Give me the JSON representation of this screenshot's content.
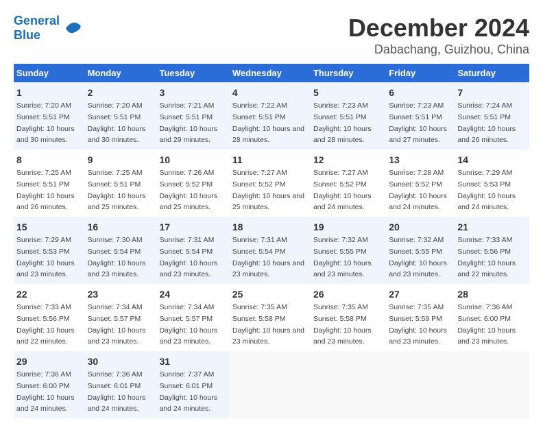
{
  "logo": {
    "text_general": "General",
    "text_blue": "Blue",
    "icon": "▶"
  },
  "title": "December 2024",
  "location": "Dabachang, Guizhou, China",
  "days_of_week": [
    "Sunday",
    "Monday",
    "Tuesday",
    "Wednesday",
    "Thursday",
    "Friday",
    "Saturday"
  ],
  "weeks": [
    [
      {
        "day": "1",
        "sunrise": "Sunrise: 7:20 AM",
        "sunset": "Sunset: 5:51 PM",
        "daylight": "Daylight: 10 hours and 30 minutes."
      },
      {
        "day": "2",
        "sunrise": "Sunrise: 7:20 AM",
        "sunset": "Sunset: 5:51 PM",
        "daylight": "Daylight: 10 hours and 30 minutes."
      },
      {
        "day": "3",
        "sunrise": "Sunrise: 7:21 AM",
        "sunset": "Sunset: 5:51 PM",
        "daylight": "Daylight: 10 hours and 29 minutes."
      },
      {
        "day": "4",
        "sunrise": "Sunrise: 7:22 AM",
        "sunset": "Sunset: 5:51 PM",
        "daylight": "Daylight: 10 hours and 28 minutes."
      },
      {
        "day": "5",
        "sunrise": "Sunrise: 7:23 AM",
        "sunset": "Sunset: 5:51 PM",
        "daylight": "Daylight: 10 hours and 28 minutes."
      },
      {
        "day": "6",
        "sunrise": "Sunrise: 7:23 AM",
        "sunset": "Sunset: 5:51 PM",
        "daylight": "Daylight: 10 hours and 27 minutes."
      },
      {
        "day": "7",
        "sunrise": "Sunrise: 7:24 AM",
        "sunset": "Sunset: 5:51 PM",
        "daylight": "Daylight: 10 hours and 26 minutes."
      }
    ],
    [
      {
        "day": "8",
        "sunrise": "Sunrise: 7:25 AM",
        "sunset": "Sunset: 5:51 PM",
        "daylight": "Daylight: 10 hours and 26 minutes."
      },
      {
        "day": "9",
        "sunrise": "Sunrise: 7:25 AM",
        "sunset": "Sunset: 5:51 PM",
        "daylight": "Daylight: 10 hours and 25 minutes."
      },
      {
        "day": "10",
        "sunrise": "Sunrise: 7:26 AM",
        "sunset": "Sunset: 5:52 PM",
        "daylight": "Daylight: 10 hours and 25 minutes."
      },
      {
        "day": "11",
        "sunrise": "Sunrise: 7:27 AM",
        "sunset": "Sunset: 5:52 PM",
        "daylight": "Daylight: 10 hours and 25 minutes."
      },
      {
        "day": "12",
        "sunrise": "Sunrise: 7:27 AM",
        "sunset": "Sunset: 5:52 PM",
        "daylight": "Daylight: 10 hours and 24 minutes."
      },
      {
        "day": "13",
        "sunrise": "Sunrise: 7:28 AM",
        "sunset": "Sunset: 5:52 PM",
        "daylight": "Daylight: 10 hours and 24 minutes."
      },
      {
        "day": "14",
        "sunrise": "Sunrise: 7:29 AM",
        "sunset": "Sunset: 5:53 PM",
        "daylight": "Daylight: 10 hours and 24 minutes."
      }
    ],
    [
      {
        "day": "15",
        "sunrise": "Sunrise: 7:29 AM",
        "sunset": "Sunset: 5:53 PM",
        "daylight": "Daylight: 10 hours and 23 minutes."
      },
      {
        "day": "16",
        "sunrise": "Sunrise: 7:30 AM",
        "sunset": "Sunset: 5:54 PM",
        "daylight": "Daylight: 10 hours and 23 minutes."
      },
      {
        "day": "17",
        "sunrise": "Sunrise: 7:31 AM",
        "sunset": "Sunset: 5:54 PM",
        "daylight": "Daylight: 10 hours and 23 minutes."
      },
      {
        "day": "18",
        "sunrise": "Sunrise: 7:31 AM",
        "sunset": "Sunset: 5:54 PM",
        "daylight": "Daylight: 10 hours and 23 minutes."
      },
      {
        "day": "19",
        "sunrise": "Sunrise: 7:32 AM",
        "sunset": "Sunset: 5:55 PM",
        "daylight": "Daylight: 10 hours and 23 minutes."
      },
      {
        "day": "20",
        "sunrise": "Sunrise: 7:32 AM",
        "sunset": "Sunset: 5:55 PM",
        "daylight": "Daylight: 10 hours and 23 minutes."
      },
      {
        "day": "21",
        "sunrise": "Sunrise: 7:33 AM",
        "sunset": "Sunset: 5:56 PM",
        "daylight": "Daylight: 10 hours and 22 minutes."
      }
    ],
    [
      {
        "day": "22",
        "sunrise": "Sunrise: 7:33 AM",
        "sunset": "Sunset: 5:56 PM",
        "daylight": "Daylight: 10 hours and 22 minutes."
      },
      {
        "day": "23",
        "sunrise": "Sunrise: 7:34 AM",
        "sunset": "Sunset: 5:57 PM",
        "daylight": "Daylight: 10 hours and 23 minutes."
      },
      {
        "day": "24",
        "sunrise": "Sunrise: 7:34 AM",
        "sunset": "Sunset: 5:57 PM",
        "daylight": "Daylight: 10 hours and 23 minutes."
      },
      {
        "day": "25",
        "sunrise": "Sunrise: 7:35 AM",
        "sunset": "Sunset: 5:58 PM",
        "daylight": "Daylight: 10 hours and 23 minutes."
      },
      {
        "day": "26",
        "sunrise": "Sunrise: 7:35 AM",
        "sunset": "Sunset: 5:58 PM",
        "daylight": "Daylight: 10 hours and 23 minutes."
      },
      {
        "day": "27",
        "sunrise": "Sunrise: 7:35 AM",
        "sunset": "Sunset: 5:59 PM",
        "daylight": "Daylight: 10 hours and 23 minutes."
      },
      {
        "day": "28",
        "sunrise": "Sunrise: 7:36 AM",
        "sunset": "Sunset: 6:00 PM",
        "daylight": "Daylight: 10 hours and 23 minutes."
      }
    ],
    [
      {
        "day": "29",
        "sunrise": "Sunrise: 7:36 AM",
        "sunset": "Sunset: 6:00 PM",
        "daylight": "Daylight: 10 hours and 24 minutes."
      },
      {
        "day": "30",
        "sunrise": "Sunrise: 7:36 AM",
        "sunset": "Sunset: 6:01 PM",
        "daylight": "Daylight: 10 hours and 24 minutes."
      },
      {
        "day": "31",
        "sunrise": "Sunrise: 7:37 AM",
        "sunset": "Sunset: 6:01 PM",
        "daylight": "Daylight: 10 hours and 24 minutes."
      },
      null,
      null,
      null,
      null
    ]
  ]
}
